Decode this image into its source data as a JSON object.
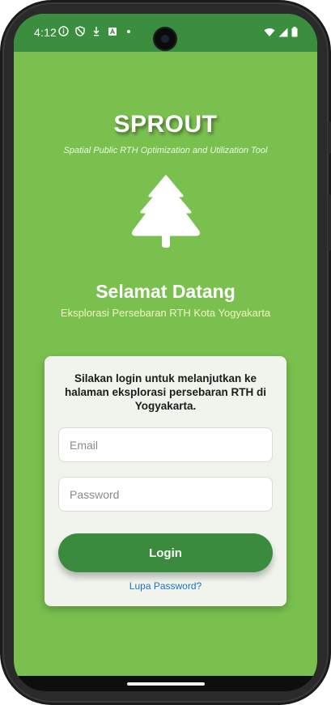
{
  "status_bar": {
    "time": "4:12",
    "left_icons": [
      "info-icon",
      "shield-icon",
      "download-icon",
      "a-icon",
      "dot-icon"
    ],
    "right_icons": [
      "wifi-icon",
      "cellular-icon",
      "battery-icon"
    ]
  },
  "header": {
    "app_name": "SPROUT",
    "tagline": "Spatial Public RTH Optimization and Utilization Tool",
    "logo_icon": "tree-icon"
  },
  "welcome": {
    "title": "Selamat Datang",
    "subtitle": "Eksplorasi Persebaran RTH Kota Yogyakarta"
  },
  "login_card": {
    "message": "Silakan login untuk melanjutkan ke halaman eksplorasi persebaran RTH di Yogyakarta.",
    "email_placeholder": "Email",
    "email_value": "",
    "password_placeholder": "Password",
    "password_value": "",
    "login_label": "Login",
    "forgot_label": "Lupa Password?"
  },
  "colors": {
    "background": "#7ac04f",
    "status_bar": "#3b8e3d",
    "primary_button": "#3a8b3e",
    "link": "#1a73c8",
    "card": "#f0f4ec"
  }
}
